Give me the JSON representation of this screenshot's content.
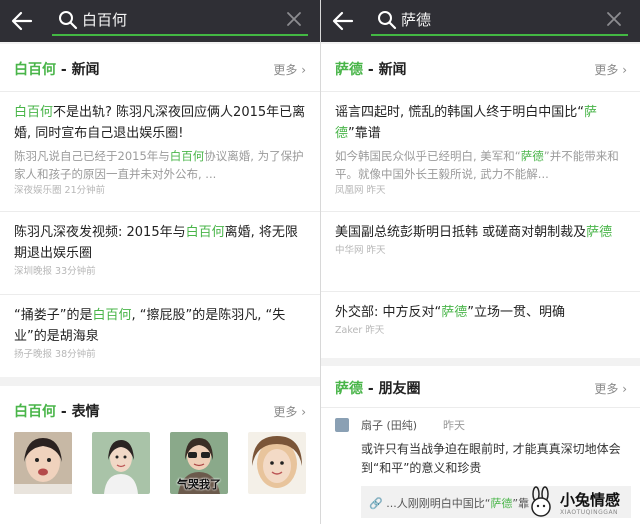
{
  "left": {
    "search": {
      "query": "白百何"
    },
    "news": {
      "title_hl": "白百何",
      "title_sep": " - ",
      "title_rest": "新闻",
      "more": "更多",
      "items": [
        {
          "title": [
            {
              "t": "白百何",
              "h": true
            },
            {
              "t": "不是出轨? 陈羽凡深夜回应俩人2015年已离婚, 同时宣布自己退出娱乐圈!",
              "h": false
            }
          ],
          "snippet": [
            {
              "t": "陈羽凡说自己已经于2015年与",
              "h": false
            },
            {
              "t": "白百何",
              "h": true
            },
            {
              "t": "协议离婚, 为了保护家人和孩子的原因一直并未对外公布, ...",
              "h": false
            }
          ],
          "meta": "深夜娱乐圈 21分钟前"
        },
        {
          "title": [
            {
              "t": "陈羽凡深夜发视频: 2015年与",
              "h": false
            },
            {
              "t": "白百何",
              "h": true
            },
            {
              "t": "离婚, 将无限期退出娱乐圈",
              "h": false
            }
          ],
          "snippet": [],
          "meta": "深圳晚报 33分钟前"
        },
        {
          "title": [
            {
              "t": "“捅娄子”的是",
              "h": false
            },
            {
              "t": "白百何",
              "h": true
            },
            {
              "t": ", “擦屁股”的是陈羽凡, “失业”的是胡海泉",
              "h": false
            }
          ],
          "snippet": [],
          "meta": "扬子晚报 38分钟前"
        }
      ]
    },
    "stickers": {
      "title_hl": "白百何",
      "title_sep": " - ",
      "title_rest": "表情",
      "more": "更多",
      "captions": [
        "",
        "",
        "气哭我了",
        ""
      ]
    }
  },
  "right": {
    "search": {
      "query": "萨德"
    },
    "news": {
      "title_hl": "萨德",
      "title_sep": " - ",
      "title_rest": "新闻",
      "more": "更多",
      "items": [
        {
          "title": [
            {
              "t": "谣言四起时, 慌乱的韩国人终于明白中国比“",
              "h": false
            },
            {
              "t": "萨德",
              "h": true
            },
            {
              "t": "”靠谱",
              "h": false
            }
          ],
          "snippet": [
            {
              "t": "如今韩国民众似乎已经明白, 美军和“",
              "h": false
            },
            {
              "t": "萨德",
              "h": true
            },
            {
              "t": "”并不能带来和平。就像中国外长王毅所说, 武力不能解...",
              "h": false
            }
          ],
          "meta": "凤凰网 昨天"
        },
        {
          "title": [
            {
              "t": "美国副总统彭斯明日抵韩 或磋商对朝制裁及",
              "h": false
            },
            {
              "t": "萨德",
              "h": true
            }
          ],
          "snippet": [],
          "meta": "中华网 昨天"
        },
        {
          "title": [
            {
              "t": "外交部: 中方反对“",
              "h": false
            },
            {
              "t": "萨德",
              "h": true
            },
            {
              "t": "”立场一贯、明确",
              "h": false
            }
          ],
          "snippet": [],
          "meta": "Zaker 昨天"
        }
      ]
    },
    "moments": {
      "title_hl": "萨德",
      "title_sep": " - ",
      "title_rest": "朋友圈",
      "more": "更多",
      "author": "扇子 (田纯)",
      "time": "昨天",
      "text": [
        {
          "t": "或许只有当战争迫在眼前时, 才能真真深切地体会到“和平”的意义和珍贵",
          "h": false
        }
      ],
      "link": [
        {
          "t": "...人刚刚明白中国比“",
          "h": false
        },
        {
          "t": "萨德",
          "h": true
        },
        {
          "t": "”靠",
          "h": false
        }
      ]
    }
  },
  "watermark": {
    "title": "小兔情感",
    "sub": "XIAOTUQINGGAN"
  },
  "colors": {
    "accent": "#49b549",
    "topbar": "#2f2f35",
    "underline": "#43b843"
  }
}
